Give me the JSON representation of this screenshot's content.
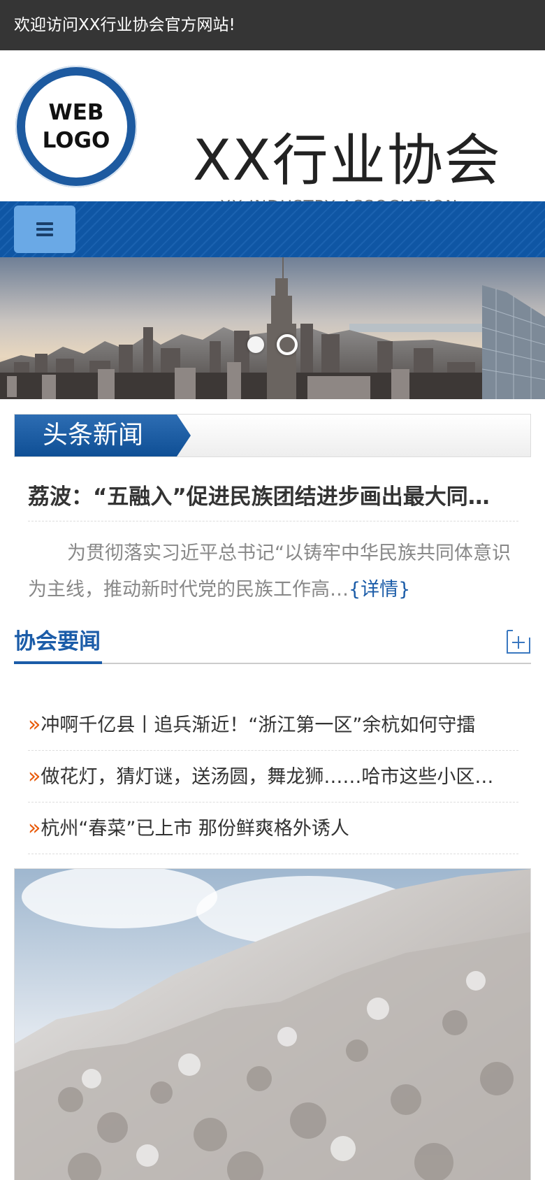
{
  "topbar": {
    "welcome": "欢迎访问XX行业协会官方网站!"
  },
  "header": {
    "logo_line1": "WEB",
    "logo_line2": "LOGO",
    "site_name": "XX行业协会",
    "site_subtitle": "XX INDUSTRY ASSOCIATION"
  },
  "nav": {
    "menu_icon": "hamburger-icon"
  },
  "banner": {
    "slides": 2,
    "active_slide": 2
  },
  "headline": {
    "tag": "头条新闻",
    "title": "荔波：“五融入”促进民族团结进步画出最大同…",
    "summary": "为贯彻落实习近平总书记“以铸牢中华民族共同体意识为主线，推动新时代党的民族工作高…",
    "more": "{详情}"
  },
  "section": {
    "title": "协会要闻",
    "more_icon": "plus-icon",
    "items": [
      {
        "bullet": "»",
        "text": "冲啊千亿县丨追兵渐近！“浙江第一区”余杭如何守擂"
      },
      {
        "bullet": "»",
        "text": "做花灯，猜灯谜，送汤圆，舞龙狮……哈市这些小区…"
      },
      {
        "bullet": "»",
        "text": "杭州“春菜”已上市 那份鲜爽格外诱人"
      }
    ]
  },
  "colors": {
    "accent": "#1b5ca8",
    "topbar": "#353535",
    "nav": "#0f56a4",
    "bullet": "#e85a0a"
  }
}
